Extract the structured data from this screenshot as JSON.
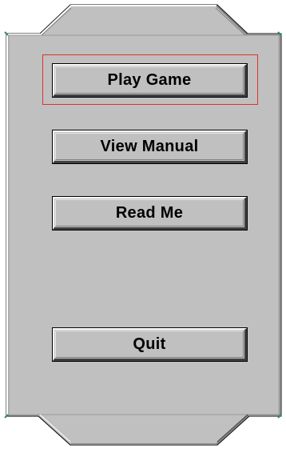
{
  "menu": {
    "buttons": [
      {
        "label": "Play Game"
      },
      {
        "label": "View Manual"
      },
      {
        "label": "Read Me"
      },
      {
        "label": "Quit"
      }
    ],
    "focused_button": "Play Game"
  },
  "colors": {
    "panel_face": "#c0c0c0",
    "panel_shadow": "#808080",
    "panel_dark": "#404040",
    "highlight": "#ffffff",
    "focus": "#e03030",
    "corner_accent": "#2e8b57"
  }
}
